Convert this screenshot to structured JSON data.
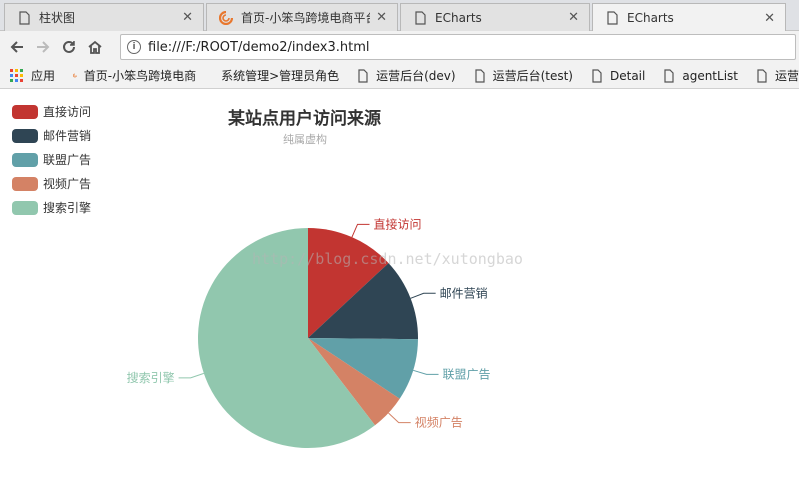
{
  "browser": {
    "tabs": [
      {
        "title": "柱状图",
        "icon": "page-icon"
      },
      {
        "title": "首页-小笨鸟跨境电商平台",
        "icon": "bird-logo-icon"
      },
      {
        "title": "ECharts",
        "icon": "page-icon"
      },
      {
        "title": "ECharts",
        "icon": "page-icon",
        "active": true
      }
    ],
    "url": "file:///F:/ROOT/demo2/index3.html",
    "bookmarks": [
      {
        "label": "应用",
        "icon": "apps-grid-icon"
      },
      {
        "label": "首页-小笨鸟跨境电商",
        "icon": "bird-logo-icon"
      },
      {
        "label": "系统管理>管理员角色",
        "icon": "page-icon"
      },
      {
        "label": "运营后台(dev)",
        "icon": "page-icon"
      },
      {
        "label": "运营后台(test)",
        "icon": "page-icon"
      },
      {
        "label": "Detail",
        "icon": "page-icon"
      },
      {
        "label": "agentList",
        "icon": "page-icon"
      },
      {
        "label": "运营",
        "icon": "page-icon"
      }
    ]
  },
  "watermark": "http://blog.csdn.net/xutongbao",
  "chart_data": {
    "type": "pie",
    "title": "某站点用户访问来源",
    "subtitle": "纯属虚构",
    "legend_position": "top-left",
    "slices": [
      {
        "name": "直接访问",
        "value": 335,
        "color": "#c23531"
      },
      {
        "name": "邮件营销",
        "value": 310,
        "color": "#2f4554"
      },
      {
        "name": "联盟广告",
        "value": 234,
        "color": "#61a0a8"
      },
      {
        "name": "视频广告",
        "value": 135,
        "color": "#d48265"
      },
      {
        "name": "搜索引擎",
        "value": 1548,
        "color": "#91c7ae"
      }
    ]
  }
}
